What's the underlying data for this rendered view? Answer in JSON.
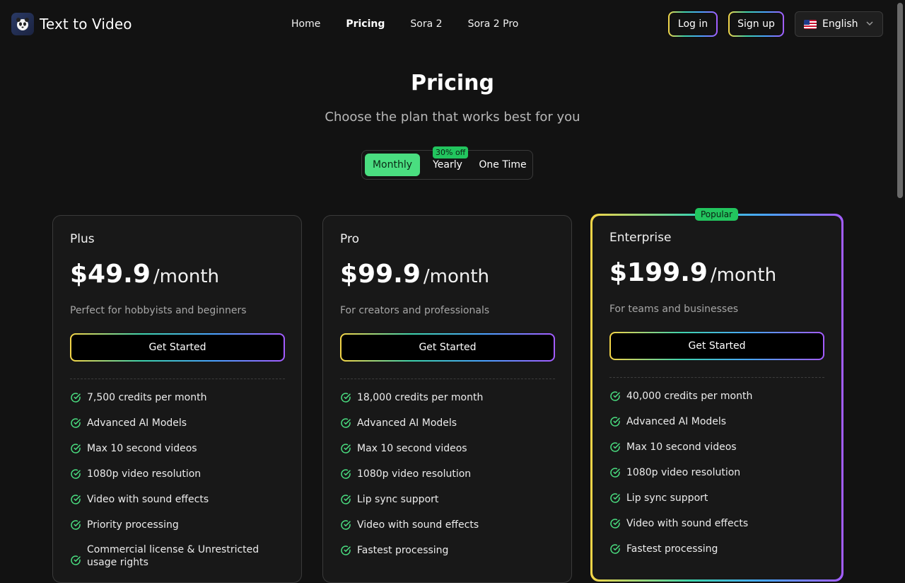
{
  "header": {
    "brand": "Text to Video",
    "nav": [
      {
        "label": "Home"
      },
      {
        "label": "Pricing"
      },
      {
        "label": "Sora 2"
      },
      {
        "label": "Sora 2 Pro"
      }
    ],
    "login_label": "Log in",
    "signup_label": "Sign up",
    "language": "English"
  },
  "hero": {
    "title": "Pricing",
    "subtitle": "Choose the plan that works best for you"
  },
  "billing_toggle": {
    "options": [
      "Monthly",
      "Yearly",
      "One Time"
    ],
    "selected": "Monthly",
    "yearly_badge": "30% off"
  },
  "plans": [
    {
      "name": "Plus",
      "price": "$49.9",
      "period": "/month",
      "description": "Perfect for hobbyists and beginners",
      "cta": "Get Started",
      "features": [
        "7,500 credits per month",
        "Advanced AI Models",
        "Max 10 second videos",
        "1080p video resolution",
        "Video with sound effects",
        "Priority processing",
        "Commercial license & Unrestricted usage rights"
      ]
    },
    {
      "name": "Pro",
      "price": "$99.9",
      "period": "/month",
      "description": "For creators and professionals",
      "cta": "Get Started",
      "features": [
        "18,000 credits per month",
        "Advanced AI Models",
        "Max 10 second videos",
        "1080p video resolution",
        "Lip sync support",
        "Video with sound effects",
        "Fastest processing"
      ]
    },
    {
      "name": "Enterprise",
      "badge": "Popular",
      "price": "$199.9",
      "period": "/month",
      "description": "For teams and businesses",
      "cta": "Get Started",
      "features": [
        "40,000 credits per month",
        "Advanced AI Models",
        "Max 10 second videos",
        "1080p video resolution",
        "Lip sync support",
        "Video with sound effects",
        "Fastest processing"
      ]
    }
  ],
  "colors": {
    "background": "#121212",
    "accent_green": "#4ade80",
    "card_bg": "#181818"
  },
  "icons": {
    "logo": "panda-logo-icon",
    "feature": "check-circle-icon",
    "language_flag": "us-flag-icon",
    "dropdown": "chevron-down-icon"
  }
}
